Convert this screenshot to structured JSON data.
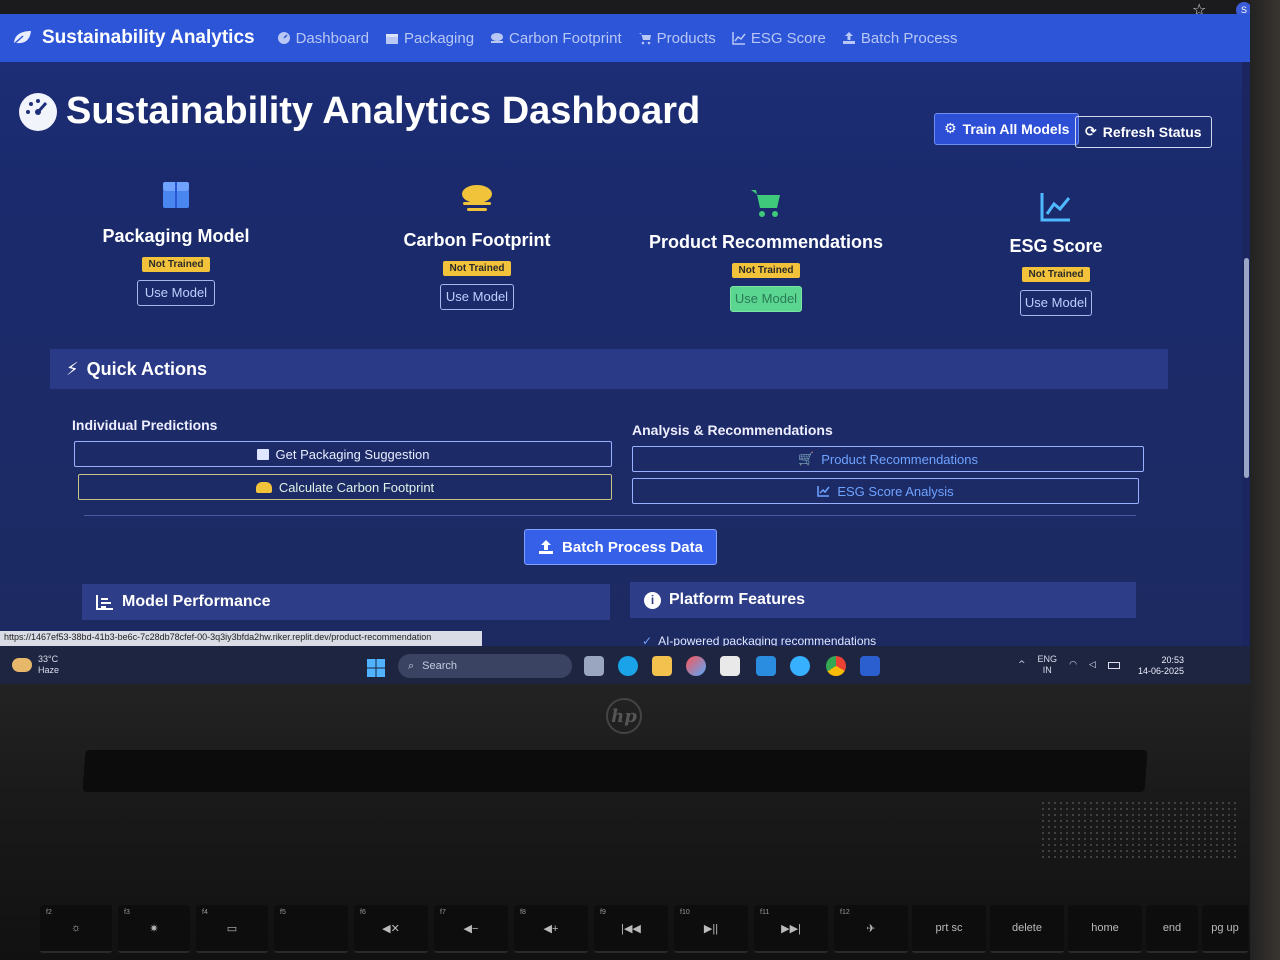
{
  "navbar": {
    "brand": "Sustainability Analytics",
    "links": [
      {
        "label": "Dashboard",
        "icon": "gauge-icon"
      },
      {
        "label": "Packaging",
        "icon": "box-icon"
      },
      {
        "label": "Carbon Footprint",
        "icon": "cloud-icon"
      },
      {
        "label": "Products",
        "icon": "cart-icon"
      },
      {
        "label": "ESG Score",
        "icon": "chart-line-icon"
      },
      {
        "label": "Batch Process",
        "icon": "upload-icon"
      }
    ]
  },
  "header": {
    "title": "Sustainability Analytics Dashboard",
    "train_button": "Train All Models",
    "refresh_button": "Refresh Status"
  },
  "models": [
    {
      "title": "Packaging Model",
      "status": "Not Trained",
      "action": "Use Model",
      "icon": "box-icon"
    },
    {
      "title": "Carbon Footprint",
      "status": "Not Trained",
      "action": "Use Model",
      "icon": "cloud-icon"
    },
    {
      "title": "Product Recommendations",
      "status": "Not Trained",
      "action": "Use Model",
      "icon": "cart-icon"
    },
    {
      "title": "ESG Score",
      "status": "Not Trained",
      "action": "Use Model",
      "icon": "chart-line-icon"
    }
  ],
  "quick_actions": {
    "title": "Quick Actions",
    "individual_title": "Individual Predictions",
    "analysis_title": "Analysis & Recommendations",
    "packaging_btn": "Get Packaging Suggestion",
    "carbon_btn": "Calculate Carbon Footprint",
    "products_btn": "Product Recommendations",
    "esg_btn": "ESG Score Analysis",
    "batch_btn": "Batch Process Data"
  },
  "model_performance": {
    "title": "Model Performance"
  },
  "platform_features": {
    "title": "Platform Features",
    "first_item": "AI-powered packaging recommendations"
  },
  "status_url": "https://1467ef53-38bd-41b3-be6c-7c28db78cfef-00-3q3iy3bfda2hw.riker.replit.dev/product-recommendation",
  "taskbar": {
    "temperature": "33°C",
    "weather": "Haze",
    "search_placeholder": "Search",
    "lang": "ENG",
    "region": "IN",
    "time": "20:53",
    "date": "14-06-2025"
  },
  "keyboard": {
    "keys": [
      "f2",
      "f3",
      "f4",
      "f5",
      "f6",
      "f7",
      "f8",
      "f9",
      "f10",
      "f11",
      "f12",
      "prt sc",
      "delete",
      "home",
      "end",
      "pg up"
    ]
  },
  "colors": {
    "navbar": "#2c55d8",
    "badge": "#f2c23a",
    "accent": "#3660e8",
    "hover_green": "#5bd690"
  }
}
